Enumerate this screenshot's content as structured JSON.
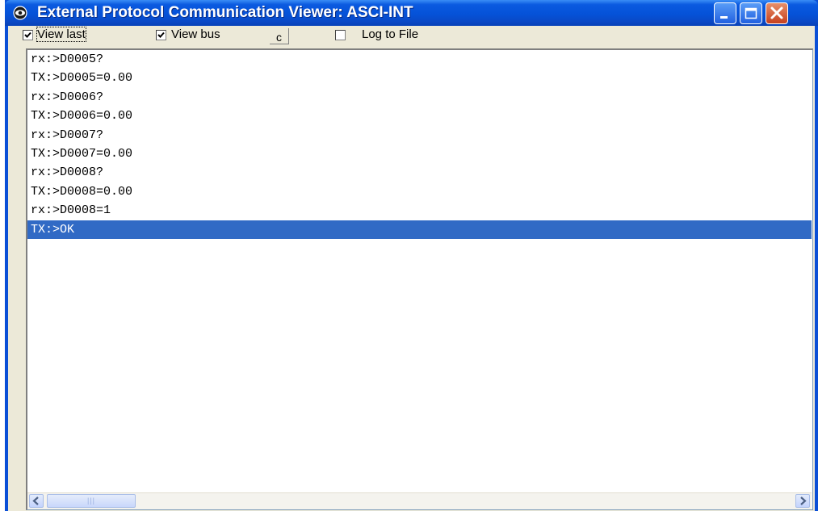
{
  "window": {
    "title": "External Protocol Communication Viewer: ASCI-INT",
    "accent_color": "#0552d8",
    "close_color": "#c6401e"
  },
  "toolbar": {
    "view_last": {
      "label": "View last",
      "checked": true
    },
    "view_bus": {
      "label": "View bus",
      "checked": true
    },
    "clear_button": "c",
    "log_to_file": {
      "label": "Log to File",
      "checked": false
    }
  },
  "log": {
    "lines": [
      "rx:>D0005?",
      "TX:>D0005=0.00",
      "rx:>D0006?",
      "TX:>D0006=0.00",
      "rx:>D0007?",
      "TX:>D0007=0.00",
      "rx:>D0008?",
      "TX:>D0008=0.00",
      "rx:>D0008=1",
      "TX:>OK"
    ],
    "selected_index": 9,
    "selection_color": "#316ac5"
  },
  "icons": {
    "app": "eye-icon",
    "minimize": "minimize-icon",
    "maximize": "maximize-icon",
    "close": "close-icon",
    "scroll_left": "arrow-left-icon",
    "scroll_right": "arrow-right-icon"
  }
}
